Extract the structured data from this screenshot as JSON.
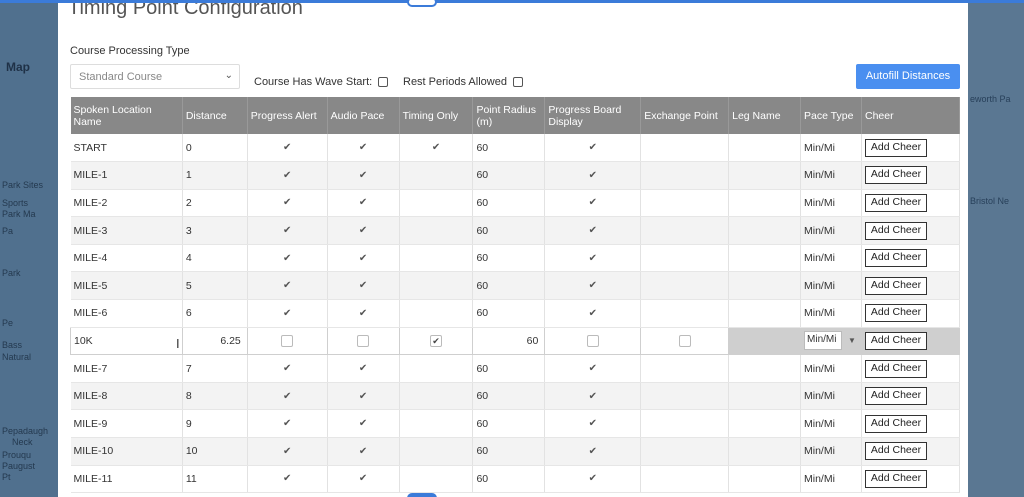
{
  "background_map": {
    "label": "Map",
    "left_texts": [
      "Park Sites",
      "Sports",
      "Park Ma",
      "Pa",
      "Park",
      "Pe",
      "Bass",
      "Natural",
      "Pepadaugh",
      "Neck",
      "Prouqu",
      "Paugust",
      "Pt"
    ],
    "right_texts": [
      "Bristol Ne",
      "eworth Pa"
    ]
  },
  "modal": {
    "title": "Timing Point Configuration",
    "course_processing_label": "Course Processing Type",
    "course_processing_value": "Standard Course",
    "wave_start_label": "Course Has Wave Start:",
    "rest_periods_label": "Rest Periods Allowed",
    "autofill_label": "Autofill Distances"
  },
  "table": {
    "headers": [
      "Spoken Location Name",
      "Distance",
      "Progress Alert",
      "Audio Pace",
      "Timing Only",
      "Point Radius (m)",
      "Progress Board Display",
      "Exchange Point",
      "Leg Name",
      "Pace Type",
      "Cheer"
    ],
    "check_glyph": "✔",
    "add_cheer_label": "Add Cheer",
    "rows": [
      {
        "name": "START",
        "distance": "0",
        "progress": true,
        "audio": true,
        "timing": true,
        "radius": "60",
        "board": true,
        "pace": "Min/Mi"
      },
      {
        "name": "MILE-1",
        "distance": "1",
        "progress": true,
        "audio": true,
        "timing": false,
        "radius": "60",
        "board": true,
        "pace": "Min/Mi"
      },
      {
        "name": "MILE-2",
        "distance": "2",
        "progress": true,
        "audio": true,
        "timing": false,
        "radius": "60",
        "board": true,
        "pace": "Min/Mi"
      },
      {
        "name": "MILE-3",
        "distance": "3",
        "progress": true,
        "audio": true,
        "timing": false,
        "radius": "60",
        "board": true,
        "pace": "Min/Mi"
      },
      {
        "name": "MILE-4",
        "distance": "4",
        "progress": true,
        "audio": true,
        "timing": false,
        "radius": "60",
        "board": true,
        "pace": "Min/Mi"
      },
      {
        "name": "MILE-5",
        "distance": "5",
        "progress": true,
        "audio": true,
        "timing": false,
        "radius": "60",
        "board": true,
        "pace": "Min/Mi"
      },
      {
        "name": "MILE-6",
        "distance": "6",
        "progress": true,
        "audio": true,
        "timing": false,
        "radius": "60",
        "board": true,
        "pace": "Min/Mi"
      },
      {
        "name": "10K",
        "distance": "6.25",
        "editing": true,
        "progress": false,
        "audio": false,
        "timing": true,
        "radius": "60",
        "board": false,
        "exchange": false,
        "pace": "Min/Mi"
      },
      {
        "name": "MILE-7",
        "distance": "7",
        "progress": true,
        "audio": true,
        "timing": false,
        "radius": "60",
        "board": true,
        "pace": "Min/Mi"
      },
      {
        "name": "MILE-8",
        "distance": "8",
        "progress": true,
        "audio": true,
        "timing": false,
        "radius": "60",
        "board": true,
        "pace": "Min/Mi"
      },
      {
        "name": "MILE-9",
        "distance": "9",
        "progress": true,
        "audio": true,
        "timing": false,
        "radius": "60",
        "board": true,
        "pace": "Min/Mi"
      },
      {
        "name": "MILE-10",
        "distance": "10",
        "progress": true,
        "audio": true,
        "timing": false,
        "radius": "60",
        "board": true,
        "pace": "Min/Mi"
      },
      {
        "name": "MILE-11",
        "distance": "11",
        "progress": true,
        "audio": true,
        "timing": false,
        "radius": "60",
        "board": true,
        "pace": "Min/Mi"
      }
    ]
  },
  "colors": {
    "header_bg": "#888888",
    "accent_button": "#4a8ff0",
    "resize_border": "#3b7bd9"
  }
}
